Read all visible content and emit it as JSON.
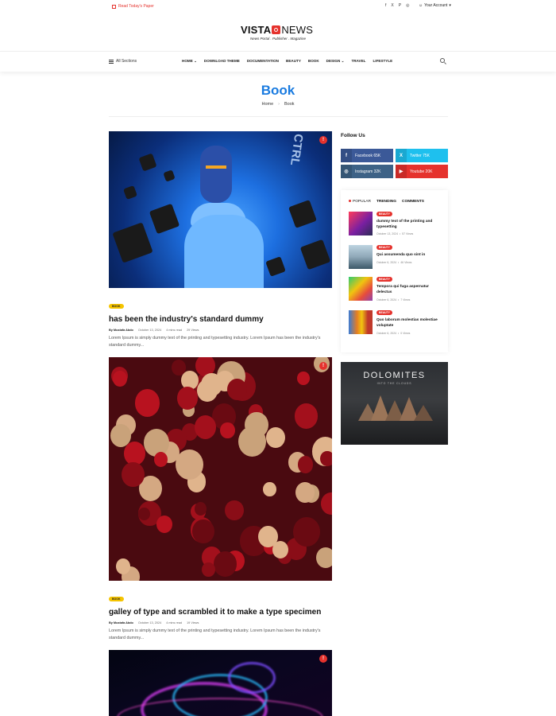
{
  "topbar": {
    "read_paper": "Read Today's Paper",
    "social_icons": [
      "facebook-icon",
      "x-icon",
      "pinterest-icon",
      "instagram-icon"
    ],
    "account": "Your Account"
  },
  "logo": {
    "vista": "VISTA",
    "news": "NEWS",
    "tagline": "News Portal  .  Publisher  .  Magazine"
  },
  "nav": {
    "all_sections": "All Sections",
    "menu": [
      "HOME",
      "DOWNLOAD THEME",
      "DOCUMENTATION",
      "BEAUTY",
      "BOOK",
      "DESIGN",
      "TRAVEL",
      "LIFESTYLE"
    ]
  },
  "page": {
    "title": "Book",
    "breadcrumb_home": "Home",
    "breadcrumb_sep": "›",
    "breadcrumb_current": "Book"
  },
  "posts": [
    {
      "category": "BOOK",
      "title": "has been the industry's standard dummy",
      "author": "By Mustafa Abdo",
      "date": "October 13, 2024",
      "read_time": "4 mins read",
      "views": "29 Views",
      "excerpt": "Lorem Ipsum is simply dummy text of the printing and typesetting industry. Lorem Ipsum has been the industry's standard dummy..."
    },
    {
      "category": "BOOK",
      "title": "galley of type and scrambled it to make a type specimen",
      "author": "By Mustafa Abdo",
      "date": "October 13, 2024",
      "read_time": "4 mins read",
      "views": "19 Views",
      "excerpt": "Lorem Ipsum is simply dummy text of the printing and typesetting industry. Lorem Ipsum has been the industry's standard dummy..."
    }
  ],
  "sidebar": {
    "follow_title": "Follow Us",
    "social": [
      {
        "label": "Facebook 65K",
        "icon": "f"
      },
      {
        "label": "Twitter 75K",
        "icon": "X"
      },
      {
        "label": "Instagram 32K",
        "icon": "◎"
      },
      {
        "label": "Youtube 20K",
        "icon": "▶"
      }
    ],
    "tabs": [
      "POPULAR",
      "TRENDING",
      "COMMENTS"
    ],
    "popular": [
      {
        "badge": "BEAUTY",
        "title": "dummy text of the printing and typesetting",
        "date": "October 13, 2024",
        "views": "57 Views"
      },
      {
        "badge": "BEAUTY",
        "title": "Qui assumenda quo sint in",
        "date": "October 6, 2024",
        "views": "46 Views"
      },
      {
        "badge": "BEAUTY",
        "title": "Tempora qui fuga aspernatur delectus",
        "date": "October 6, 2024",
        "views": "7 Views"
      },
      {
        "badge": "BEAUTY",
        "title": "Quo laborum molestias molestiae voluptate",
        "date": "October 6, 2024",
        "views": "0 Views"
      }
    ],
    "ad": {
      "title": "DOLOMITES",
      "subtitle": "INTO THE CLOUDS"
    }
  }
}
